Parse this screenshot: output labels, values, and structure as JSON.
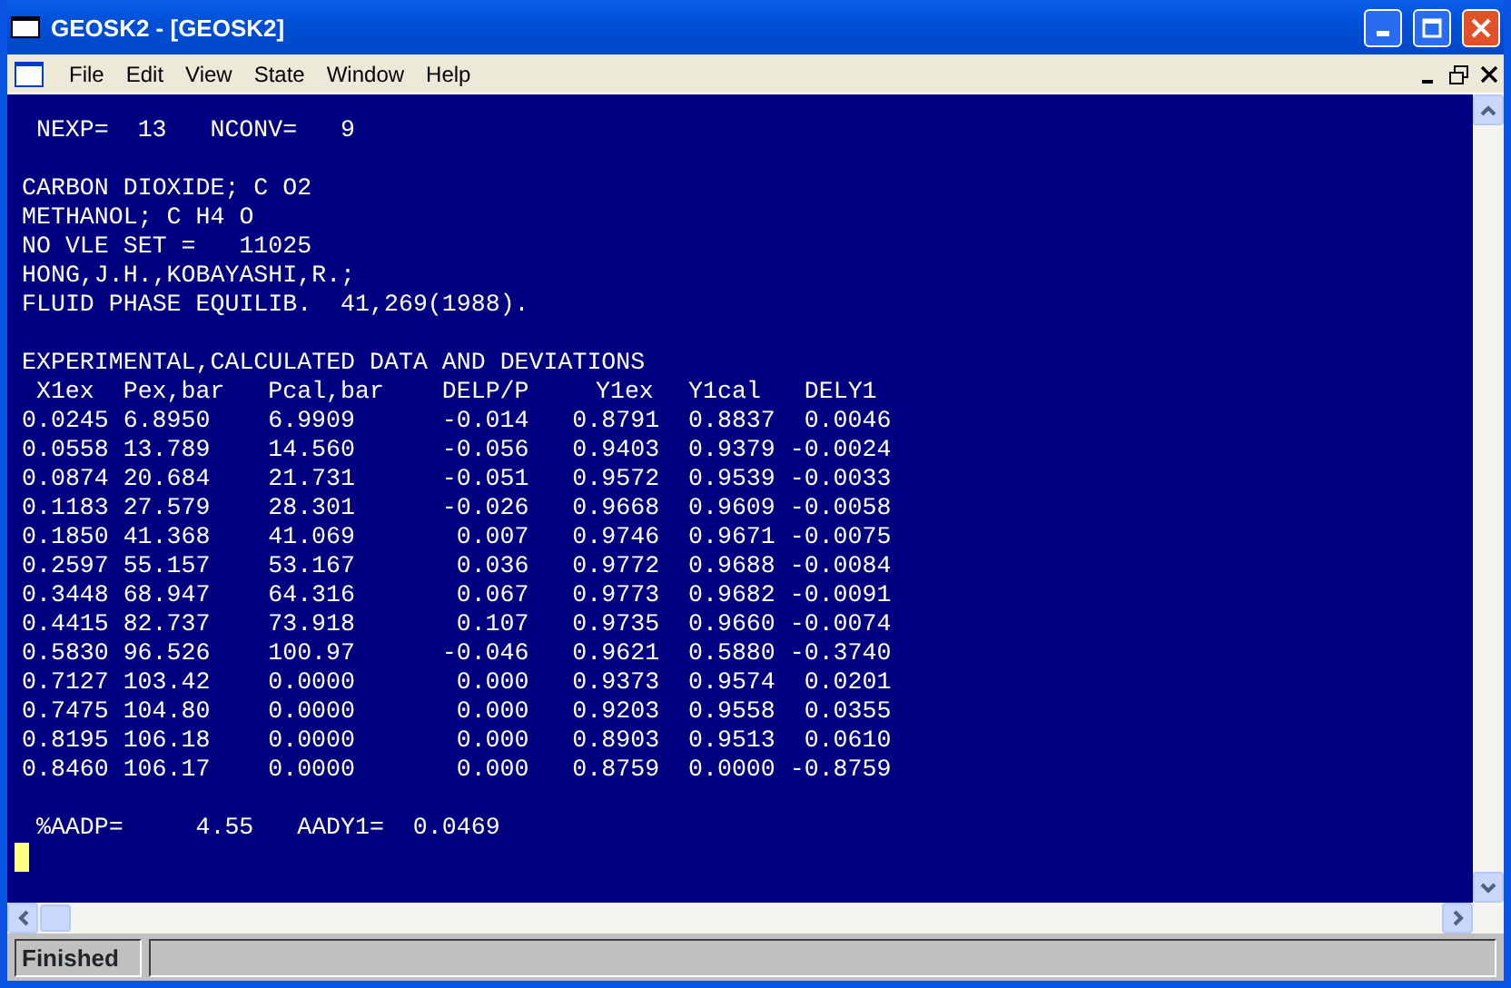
{
  "window": {
    "title": "GEOSK2 - [GEOSK2]"
  },
  "menu": [
    "File",
    "Edit",
    "View",
    "State",
    "Window",
    "Help"
  ],
  "output": {
    "run_line": "NEXP=  13   NCONV=   9",
    "info_lines": [
      "CARBON DIOXIDE; C O2",
      "METHANOL; C H4 O",
      "NO VLE SET =   11025",
      "HONG,J.H.,KOBAYASHI,R.;",
      "FLUID PHASE EQUILIB.  41,269(1988)."
    ],
    "table_title": "EXPERIMENTAL,CALCULATED DATA AND DEVIATIONS",
    "columns": [
      "X1ex",
      "Pex,bar",
      "Pcal,bar",
      "DELP/P",
      "Y1ex",
      "Y1cal",
      "DELY1"
    ],
    "rows": [
      [
        "0.0245",
        "6.8950",
        "6.9909",
        "-0.014",
        "0.8791",
        "0.8837",
        "0.0046"
      ],
      [
        "0.0558",
        "13.789",
        "14.560",
        "-0.056",
        "0.9403",
        "0.9379",
        "-0.0024"
      ],
      [
        "0.0874",
        "20.684",
        "21.731",
        "-0.051",
        "0.9572",
        "0.9539",
        "-0.0033"
      ],
      [
        "0.1183",
        "27.579",
        "28.301",
        "-0.026",
        "0.9668",
        "0.9609",
        "-0.0058"
      ],
      [
        "0.1850",
        "41.368",
        "41.069",
        "0.007",
        "0.9746",
        "0.9671",
        "-0.0075"
      ],
      [
        "0.2597",
        "55.157",
        "53.167",
        "0.036",
        "0.9772",
        "0.9688",
        "-0.0084"
      ],
      [
        "0.3448",
        "68.947",
        "64.316",
        "0.067",
        "0.9773",
        "0.9682",
        "-0.0091"
      ],
      [
        "0.4415",
        "82.737",
        "73.918",
        "0.107",
        "0.9735",
        "0.9660",
        "-0.0074"
      ],
      [
        "0.5830",
        "96.526",
        "100.97",
        "-0.046",
        "0.9621",
        "0.5880",
        "-0.3740"
      ],
      [
        "0.7127",
        "103.42",
        "0.0000",
        "0.000",
        "0.9373",
        "0.9574",
        "0.0201"
      ],
      [
        "0.7475",
        "104.80",
        "0.0000",
        "0.000",
        "0.9203",
        "0.9558",
        "0.0355"
      ],
      [
        "0.8195",
        "106.18",
        "0.0000",
        "0.000",
        "0.8903",
        "0.9513",
        "0.0610"
      ],
      [
        "0.8460",
        "106.17",
        "0.0000",
        "0.000",
        "0.8759",
        "0.0000",
        "-0.8759"
      ]
    ],
    "summary": "%AADP=     4.55   AADY1=  0.0469"
  },
  "status_bar": {
    "text": "Finished"
  }
}
